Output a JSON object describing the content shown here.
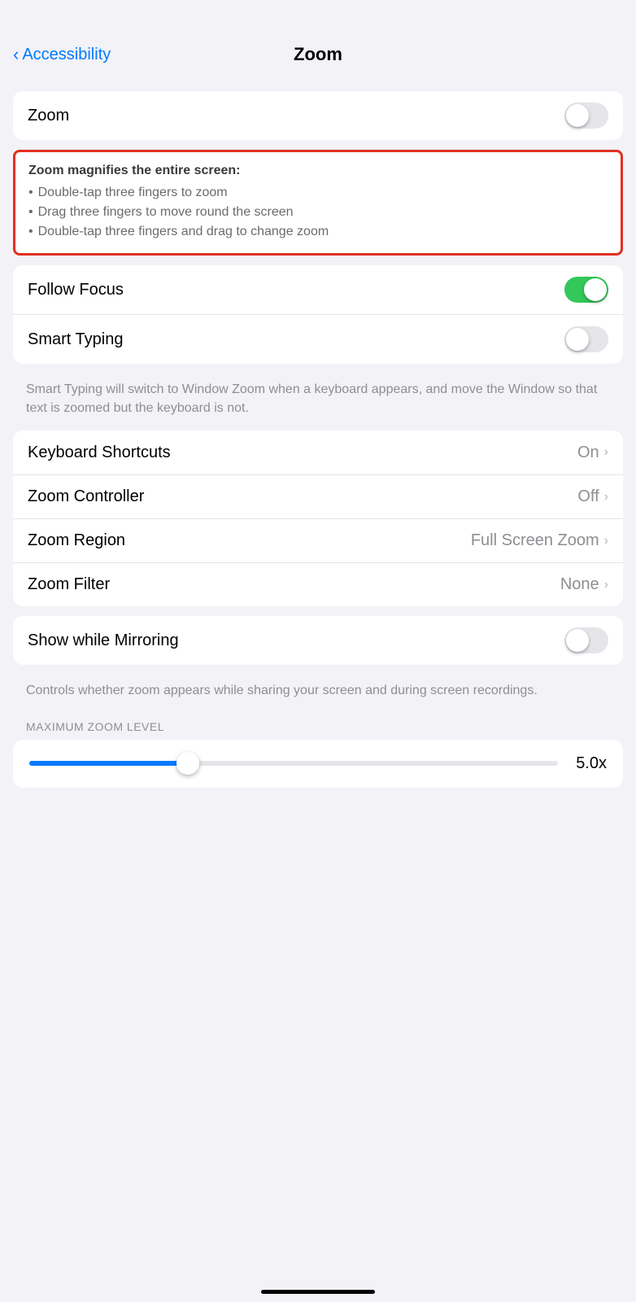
{
  "header": {
    "back_label": "Accessibility",
    "title": "Zoom"
  },
  "zoom_section": {
    "label": "Zoom",
    "toggle_state": "off"
  },
  "info_box": {
    "title": "Zoom magnifies the entire screen:",
    "items": [
      "Double-tap three fingers to zoom",
      "Drag three fingers to move round the screen",
      "Double-tap three fingers and drag to change zoom"
    ]
  },
  "follow_focus": {
    "label": "Follow Focus",
    "toggle_state": "on"
  },
  "smart_typing": {
    "label": "Smart Typing",
    "toggle_state": "off",
    "description": "Smart Typing will switch to Window Zoom when a keyboard appears, and move the Window so that text is zoomed but the keyboard is not."
  },
  "settings_rows": [
    {
      "label": "Keyboard Shortcuts",
      "value": "On"
    },
    {
      "label": "Zoom Controller",
      "value": "Off"
    },
    {
      "label": "Zoom Region",
      "value": "Full Screen Zoom"
    },
    {
      "label": "Zoom Filter",
      "value": "None"
    }
  ],
  "mirroring": {
    "label": "Show while Mirroring",
    "toggle_state": "off",
    "description": "Controls whether zoom appears while sharing your screen and during screen recordings."
  },
  "zoom_level": {
    "section_label": "MAXIMUM ZOOM LEVEL",
    "value": "5.0x",
    "fill_percent": 30
  },
  "icons": {
    "back_chevron": "‹",
    "chevron_right": "›"
  }
}
